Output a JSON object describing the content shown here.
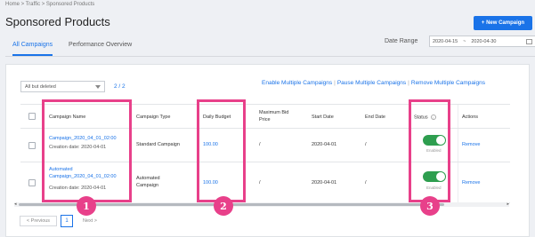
{
  "breadcrumb": "Home > Traffic > Sponsored Products",
  "page_title": "Sponsored Products",
  "new_campaign_label": "+ New Campaign",
  "tabs": [
    {
      "label": "All Campaigns",
      "active": true
    },
    {
      "label": "Performance Overview",
      "active": false
    }
  ],
  "date_range": {
    "label": "Date Range",
    "start": "2020-04-15",
    "separator": "~",
    "end": "2020-04-30"
  },
  "filter": {
    "value": "All but deleted"
  },
  "page_count": "2 / 2",
  "bulk_actions": [
    "Enable Multiple Campaigns",
    "Pause Multiple Campaigns",
    "Remove Multiple Campaigns"
  ],
  "table": {
    "headers": {
      "name": "Campaign Name",
      "type": "Campaign Type",
      "budget": "Daily Budget",
      "max_bid": "Maximum Bid Price",
      "start": "Start Date",
      "end": "End Date",
      "status": "Status",
      "actions": "Actions"
    },
    "rows": [
      {
        "name": "Campaign_2020_04_01_02:00",
        "creation": "Creation date: 2020-04-01",
        "type": "Standard Campaign",
        "budget": "100.00",
        "max_bid": "/",
        "start": "2020-04-01",
        "end": "/",
        "status": "Enabled",
        "action": "Remove"
      },
      {
        "name": "Automated Campaign_2020_04_01_02:00",
        "creation": "Creation date: 2020-04-01",
        "type": "Automated Campaign",
        "budget": "100.00",
        "max_bid": "/",
        "start": "2020-04-01",
        "end": "/",
        "status": "Enabled",
        "action": "Remove"
      }
    ]
  },
  "pagination": {
    "previous": "< Previous",
    "current": "1",
    "next": "Next >"
  },
  "annotations": [
    "1",
    "2",
    "3"
  ],
  "colors": {
    "accent": "#1a73e8",
    "highlight": "#e8408a",
    "toggle_on": "#2e9e4f"
  }
}
